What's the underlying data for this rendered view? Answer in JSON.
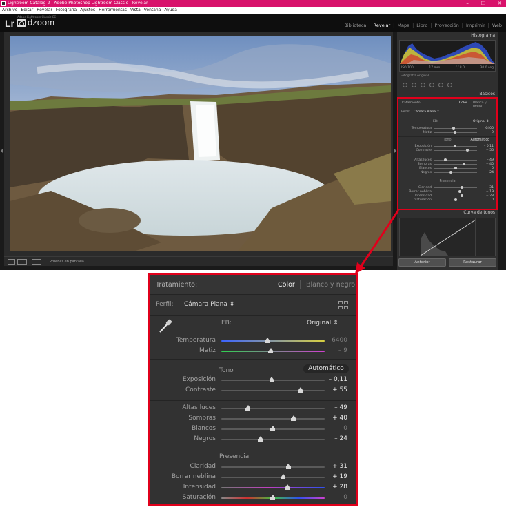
{
  "window": {
    "title": "Lightroom Catalog-2 - Adobe Photoshop Lightroom Classic - Revelar",
    "controls": [
      "–",
      "❐",
      "✕"
    ]
  },
  "menu": [
    "Archivo",
    "Editar",
    "Revelar",
    "Fotografía",
    "Ajustes",
    "Herramientas",
    "Vista",
    "Ventana",
    "Ayuda"
  ],
  "identity": {
    "product_line": "Adobe Lightroom Classic CC",
    "lr": "Lr",
    "brand": "dzoom"
  },
  "modules": {
    "items": [
      "Biblioteca",
      "Revelar",
      "Mapa",
      "Libro",
      "Proyección",
      "Imprimir",
      "Web"
    ],
    "active": "Revelar"
  },
  "toolbar": {
    "soft_proof": "Pruebas en pantalla"
  },
  "right_panel": {
    "histogram_title": "Histograma",
    "hist_info": [
      "ISO 100",
      "17 mm",
      "f / 8.0",
      "30.0 seg"
    ],
    "original_photo": "Fotografía original",
    "basic_title": "Básicos",
    "tone_curve_title": "Curva de tonos",
    "btn_previous": "Anterior",
    "btn_reset": "Restaurar"
  },
  "basic": {
    "treatment_label": "Tratamiento:",
    "treatment_color": "Color",
    "treatment_bw": "Blanco y negro",
    "profile_label": "Perfil:",
    "profile_value": "Cámara Plana ⇕",
    "wb_label": "EB:",
    "wb_value": "Original ⇕",
    "tone_header": "Tono",
    "auto_label": "Automático",
    "presence_header": "Presencia",
    "sliders": {
      "temperatura": {
        "label": "Temperatura",
        "value": "6400",
        "pos": 0.45
      },
      "matiz": {
        "label": "Matiz",
        "value": "– 9",
        "pos": 0.48
      },
      "exposicion": {
        "label": "Exposición",
        "value": "– 0,11",
        "pos": 0.49
      },
      "contraste": {
        "label": "Contraste",
        "value": "+ 55",
        "pos": 0.77
      },
      "altas_luces": {
        "label": "Altas luces",
        "value": "– 49",
        "pos": 0.26
      },
      "sombras": {
        "label": "Sombras",
        "value": "+ 40",
        "pos": 0.7
      },
      "blancos": {
        "label": "Blancos",
        "value": "0",
        "pos": 0.5
      },
      "negros": {
        "label": "Negros",
        "value": "– 24",
        "pos": 0.38
      },
      "claridad": {
        "label": "Claridad",
        "value": "+ 31",
        "pos": 0.65
      },
      "borrar_neblina": {
        "label": "Borrar neblina",
        "value": "+ 19",
        "pos": 0.6
      },
      "intensidad": {
        "label": "Intensidad",
        "value": "+ 28",
        "pos": 0.64
      },
      "saturacion": {
        "label": "Saturación",
        "value": "0",
        "pos": 0.5
      }
    }
  },
  "colors": {
    "highlight": "#e0001b",
    "titlebar": "#d8126b",
    "panel": "#323232"
  }
}
